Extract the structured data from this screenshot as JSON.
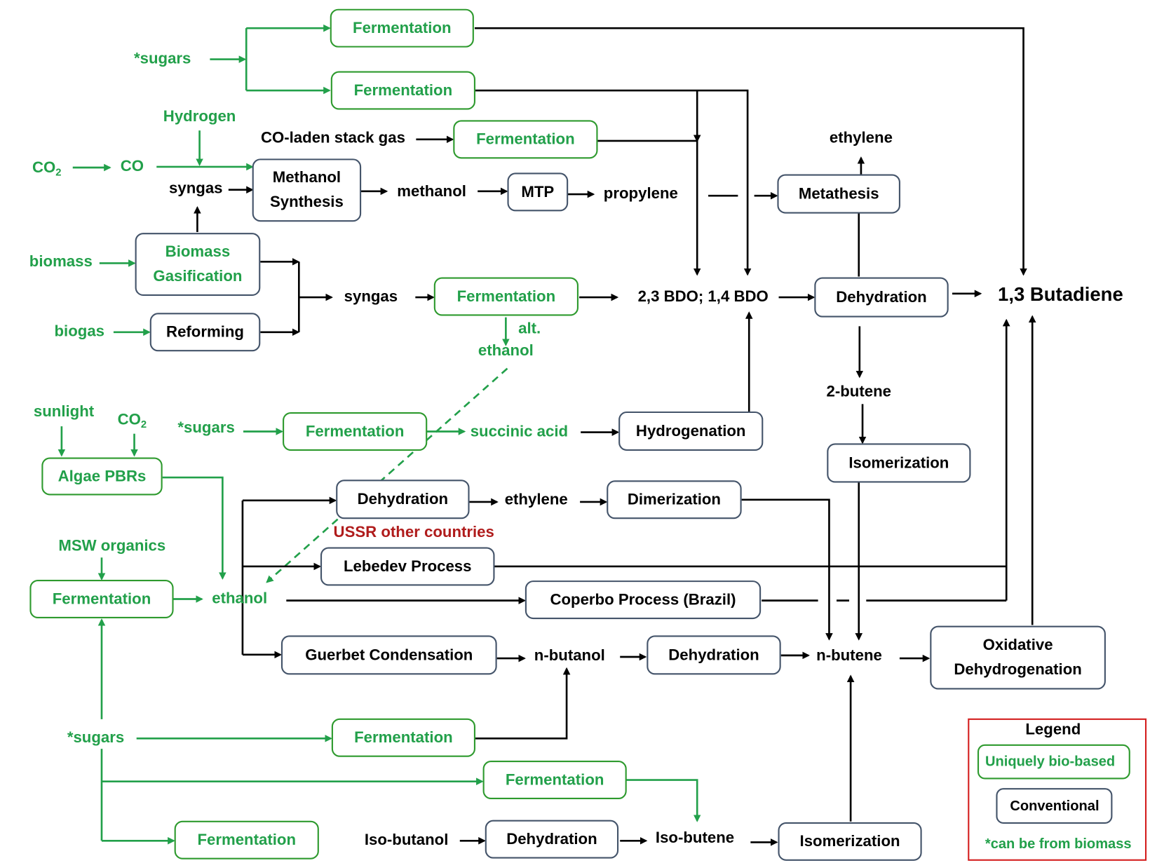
{
  "nodes": {
    "ferm_top1": {
      "label": "Fermentation",
      "kind": "bio"
    },
    "ferm_top2": {
      "label": "Fermentation",
      "kind": "bio"
    },
    "ferm_stack": {
      "label": "Fermentation",
      "kind": "bio"
    },
    "methanol_synthesis": {
      "lines": [
        "Methanol",
        "Synthesis"
      ],
      "kind": "conventional"
    },
    "mtp": {
      "label": "MTP",
      "kind": "conventional"
    },
    "metathesis": {
      "label": "Metathesis",
      "kind": "conventional"
    },
    "biomass_gasification": {
      "lines": [
        "Biomass",
        "Gasification"
      ],
      "kind": "conventional"
    },
    "reforming": {
      "label": "Reforming",
      "kind": "conventional"
    },
    "ferm_syngas": {
      "label": "Fermentation",
      "kind": "bio"
    },
    "dehydration_bdo": {
      "label": "Dehydration",
      "kind": "conventional"
    },
    "ferm_succinic": {
      "label": "Fermentation",
      "kind": "bio"
    },
    "hydrogenation": {
      "label": "Hydrogenation",
      "kind": "conventional"
    },
    "isomerization_2butene": {
      "label": "Isomerization",
      "kind": "conventional"
    },
    "algae_pbrs": {
      "label": "Algae PBRs",
      "kind": "bio"
    },
    "dehydration_ethanol": {
      "label": "Dehydration",
      "kind": "conventional"
    },
    "dimerization": {
      "label": "Dimerization",
      "kind": "conventional"
    },
    "lebedev": {
      "label": "Lebedev Process",
      "kind": "conventional"
    },
    "ferm_msw": {
      "label": "Fermentation",
      "kind": "bio"
    },
    "coperbo": {
      "label": "Coperbo Process (Brazil)",
      "kind": "conventional"
    },
    "guerbet": {
      "label": "Guerbet Condensation",
      "kind": "conventional"
    },
    "dehydration_butanol": {
      "label": "Dehydration",
      "kind": "conventional"
    },
    "oxidative_dehydrogenation": {
      "lines": [
        "Oxidative",
        "Dehydrogenation"
      ],
      "kind": "conventional"
    },
    "ferm_butanol": {
      "label": "Fermentation",
      "kind": "bio"
    },
    "ferm_isobutene": {
      "label": "Fermentation",
      "kind": "bio"
    },
    "ferm_isobutanol": {
      "label": "Fermentation",
      "kind": "bio"
    },
    "dehydration_isobutanol": {
      "label": "Dehydration",
      "kind": "conventional"
    },
    "isomerization_isobutene": {
      "label": "Isomerization",
      "kind": "conventional"
    }
  },
  "labels": {
    "sugars_top": "*sugars",
    "hydrogen": "Hydrogen",
    "co_stack_gas": "CO-laden stack gas",
    "co2_top": {
      "main": "CO",
      "sub": "2"
    },
    "co": "CO",
    "syngas_1": "syngas",
    "methanol": "methanol",
    "propylene": "propylene",
    "ethylene_top": "ethylene",
    "biomass": "biomass",
    "syngas_2": "syngas",
    "biogas": "biogas",
    "bdo": "2,3 BDO; 1,4 BDO",
    "butadiene": "1,3 Butadiene",
    "alt": "alt.",
    "alt_ethanol": "ethanol",
    "butene_2": "2-butene",
    "sunlight": "sunlight",
    "co2_algae": {
      "main": "CO",
      "sub": "2"
    },
    "sugars_mid": "*sugars",
    "succinic_acid": "succinic acid",
    "ethylene_mid": "ethylene",
    "ussr": "USSR other countries",
    "msw_organics": "MSW organics",
    "ethanol": "ethanol",
    "n_butanol": "n-butanol",
    "n_butene": "n-butene",
    "sugars_bottom": "*sugars",
    "iso_butanol": "Iso-butanol",
    "iso_butene": "Iso-butene"
  },
  "legend": {
    "title": "Legend",
    "bio": "Uniquely bio-based",
    "conventional": "Conventional",
    "note": "*can be from biomass"
  },
  "colors": {
    "bio": "#22a04a",
    "conventional_border": "#44546a",
    "legend_border": "#d42020",
    "highlight_text": "#b01c1c"
  }
}
